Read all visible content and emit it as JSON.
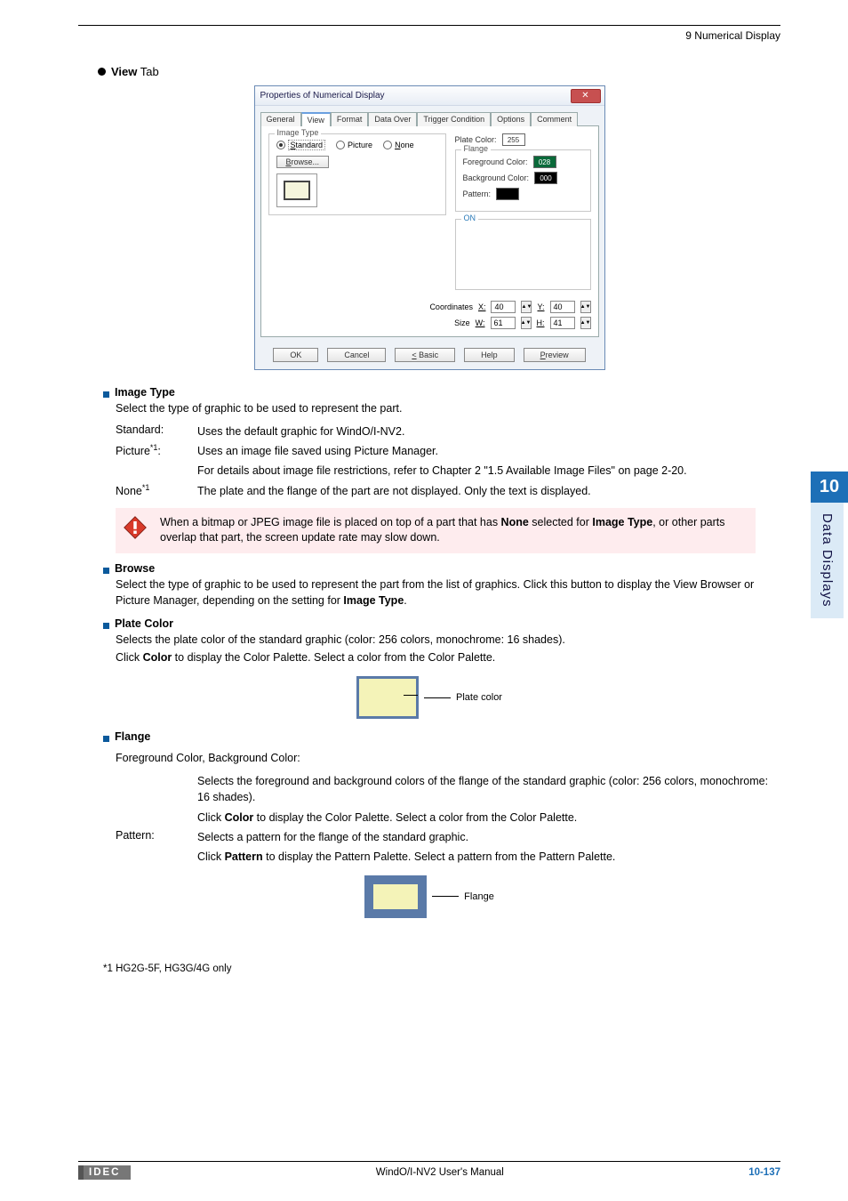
{
  "header": {
    "section": "9 Numerical Display"
  },
  "tab_heading": {
    "bold": "View",
    "suffix": " Tab"
  },
  "dialog": {
    "title": "Properties of Numerical Display",
    "close_glyph": "✕",
    "tabs": [
      "General",
      "View",
      "Format",
      "Data Over",
      "Trigger Condition",
      "Options",
      "Comment"
    ],
    "image_type_group": "Image Type",
    "radios": {
      "standard": "Standard",
      "picture": "Picture",
      "none": "None"
    },
    "browse_btn": "Browse...",
    "plate_color_label": "Plate Color:",
    "plate_color_val": "255",
    "flange_group": "Flange",
    "fg_label": "Foreground Color:",
    "fg_val": "028",
    "bg_label": "Background Color:",
    "bg_val": "000",
    "pattern_label": "Pattern:",
    "on_group": "ON",
    "coord_label": "Coordinates",
    "size_label": "Size",
    "x": "X:",
    "y": "Y:",
    "w": "W:",
    "h": "H:",
    "xv": "40",
    "yv": "40",
    "wv": "61",
    "hv": "41",
    "buttons": {
      "ok": "OK",
      "cancel": "Cancel",
      "basic": "< Basic",
      "help": "Help",
      "preview": "Preview"
    }
  },
  "sections": {
    "image_type": {
      "title": "Image Type",
      "intro": "Select the type of graphic to be used to represent the part.",
      "rows": [
        {
          "term": "Standard:",
          "desc": "Uses the default graphic for WindO/I-NV2."
        },
        {
          "term": "Picture*1:",
          "desc": "Uses an image file saved using Picture Manager."
        },
        {
          "term": "",
          "desc": "For details about image file restrictions, refer to Chapter 2 \"1.5 Available Image Files\" on page 2-20."
        },
        {
          "term": "None*1",
          "desc": "The plate and the flange of the part are not displayed. Only the text is displayed."
        }
      ],
      "note": "When a bitmap or JPEG image file is placed on top of a part that has None selected for Image Type, or other parts overlap that part, the screen update rate may slow down."
    },
    "browse": {
      "title": "Browse",
      "body": "Select the type of graphic to be used to represent the part from the list of graphics. Click this button to display the View Browser or Picture Manager, depending on the setting for Image Type."
    },
    "plate_color": {
      "title": "Plate Color",
      "l1": "Selects the plate color of the standard graphic (color: 256 colors, monochrome: 16 shades).",
      "l2": "Click Color to display the Color Palette. Select a color from the Color Palette.",
      "caption": "Plate color"
    },
    "flange": {
      "title": "Flange",
      "fgbg_label": "Foreground Color, Background Color:",
      "fgbg_desc1": "Selects the foreground and background colors of the flange of the standard graphic (color: 256 colors, monochrome: 16 shades).",
      "fgbg_desc2": "Click Color to display the Color Palette. Select a color from the Color Palette.",
      "pattern_label": "Pattern:",
      "pattern_desc1": "Selects a pattern for the flange of the standard graphic.",
      "pattern_desc2": "Click Pattern to display the Pattern Palette. Select a pattern from the Pattern Palette.",
      "caption": "Flange"
    }
  },
  "footnote": "*1  HG2G-5F, HG3G/4G only",
  "side": {
    "num": "10",
    "label": "Data Displays"
  },
  "footer": {
    "brand": "IDEC",
    "center": "WindO/I-NV2 User's Manual",
    "page": "10-137"
  }
}
